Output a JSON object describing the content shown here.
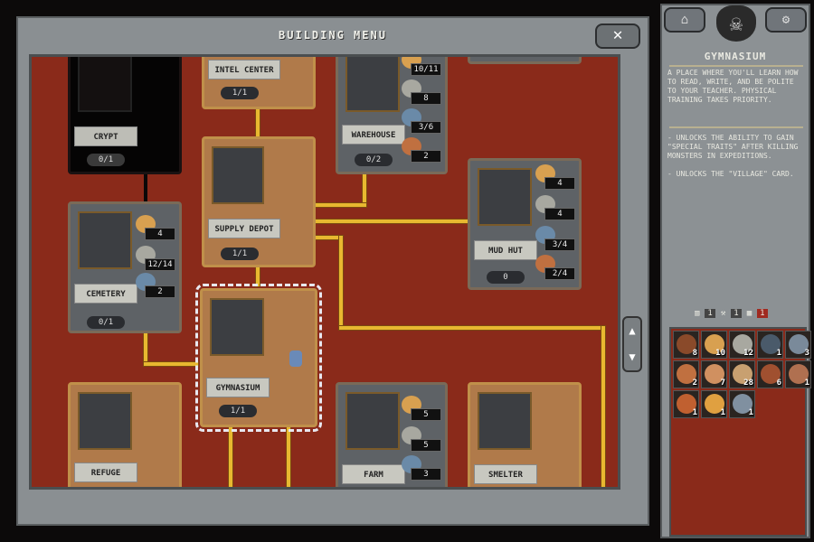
{
  "window": {
    "title": "BUILDING MENU",
    "close_icon": "close-x-icon"
  },
  "buildings": [
    {
      "id": "crypt",
      "name": "CRYPT",
      "count": "0/1",
      "style": "black",
      "resources": []
    },
    {
      "id": "intel-center",
      "name": "INTEL CENTER",
      "count": "1/1",
      "style": "built",
      "resources": []
    },
    {
      "id": "warehouse",
      "name": "WAREHOUSE",
      "count": "0/2",
      "style": "gray",
      "resources": [
        {
          "icon": "wood-icon",
          "value": "10/11",
          "short": true
        },
        {
          "icon": "stone-icon",
          "value": "8"
        },
        {
          "icon": "metal-orb-icon",
          "value": "3/6",
          "short": true
        },
        {
          "icon": "food-orb-icon",
          "value": "2"
        }
      ]
    },
    {
      "id": "supply-depot",
      "name": "SUPPLY DEPOT",
      "count": "1/1",
      "style": "built",
      "resources": []
    },
    {
      "id": "mud-hut",
      "name": "MUD HUT",
      "count": "0",
      "style": "gray",
      "resources": [
        {
          "icon": "wood-icon",
          "value": "4"
        },
        {
          "icon": "stone-icon",
          "value": "4"
        },
        {
          "icon": "metal-orb-icon",
          "value": "3/4",
          "short": true
        },
        {
          "icon": "food-orb-icon",
          "value": "2/4",
          "short": true
        }
      ]
    },
    {
      "id": "cemetery",
      "name": "CEMETERY",
      "count": "0/1",
      "style": "gray",
      "resources": [
        {
          "icon": "wood-icon",
          "value": "4"
        },
        {
          "icon": "stone-icon",
          "value": "12/14",
          "short": true
        },
        {
          "icon": "metal-orb-icon",
          "value": "2"
        }
      ]
    },
    {
      "id": "gymnasium",
      "name": "GYMNASIUM",
      "count": "1/1",
      "style": "built",
      "selected": true,
      "resources": []
    },
    {
      "id": "refuge",
      "name": "REFUGE",
      "style": "built",
      "resources": []
    },
    {
      "id": "farm",
      "name": "FARM",
      "style": "gray",
      "resources": [
        {
          "icon": "wood-icon",
          "value": "5"
        },
        {
          "icon": "stone-icon",
          "value": "5"
        },
        {
          "icon": "metal-orb-icon",
          "value": "3"
        }
      ]
    },
    {
      "id": "smelter",
      "name": "SMELTER",
      "style": "built",
      "resources": []
    }
  ],
  "side": {
    "title": "GYMNASIUM",
    "description": "A PLACE WHERE YOU'LL LEARN HOW TO READ, WRITE, AND BE POLITE TO YOUR TEACHER. PHYSICAL TRAINING TAKES PRIORITY.",
    "effects": [
      "- UNLOCKS THE ABILITY TO GAIN \"SPECIAL TRAITS\" AFTER KILLING MONSTERS IN EXPEDITIONS.",
      "- UNLOCKS THE \"VILLAGE\" CARD."
    ],
    "counters": [
      {
        "icon": "camp-icon",
        "value": "1"
      },
      {
        "icon": "craft-icon",
        "value": "1"
      },
      {
        "icon": "map-icon",
        "value": "1",
        "alert": true
      }
    ],
    "inventory": [
      {
        "icon": "branches-icon",
        "qty": "8",
        "color": "#8a4a2a"
      },
      {
        "icon": "wood-icon",
        "qty": "10",
        "color": "#d8a050"
      },
      {
        "icon": "stone-icon",
        "qty": "12",
        "color": "#a8a8a0"
      },
      {
        "icon": "metal-scrap-icon",
        "qty": "1",
        "color": "#4a5a6a"
      },
      {
        "icon": "stable-metal-icon",
        "qty": "3",
        "color": "#7a8a9a"
      },
      {
        "icon": "food-supply-icon",
        "qty": "2",
        "color": "#c07040"
      },
      {
        "icon": "ration-icon",
        "qty": "7",
        "color": "#d09060"
      },
      {
        "icon": "book-icon",
        "qty": "28",
        "color": "#c8a070"
      },
      {
        "icon": "shapeless-mass-icon",
        "qty": "6",
        "color": "#a05030"
      },
      {
        "icon": "orb-expansion-icon",
        "qty": "1",
        "color": "#b07050"
      },
      {
        "icon": "craft-fragment-icon",
        "qty": "1",
        "color": "#c06030"
      },
      {
        "icon": "orb-afterlife-icon",
        "qty": "1",
        "color": "#e0a040"
      },
      {
        "icon": "orb-unity-icon",
        "qty": "1",
        "color": "#8090a0"
      }
    ]
  },
  "colors": {
    "board": "#8a2a1a",
    "path": "#e8b830",
    "frame": "#8a8f92"
  }
}
